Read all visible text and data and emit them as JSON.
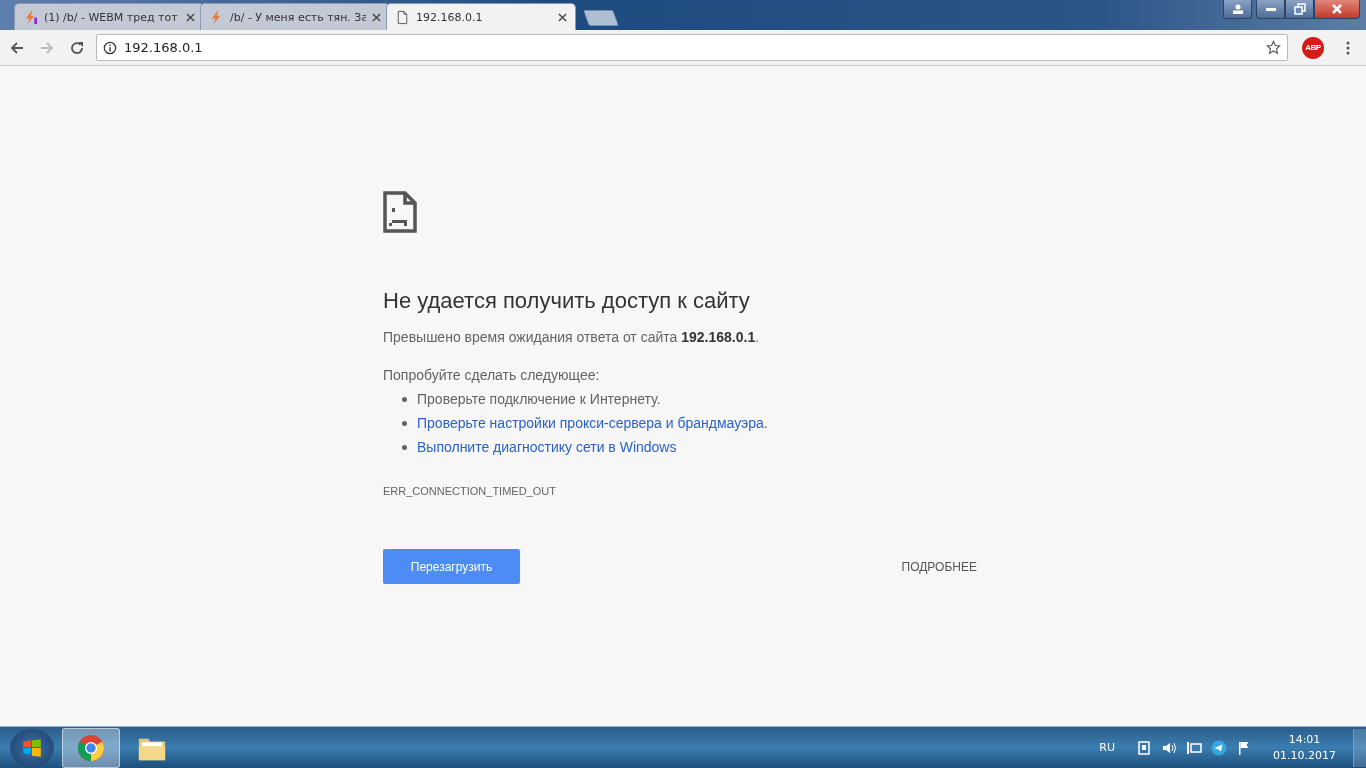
{
  "tabs": [
    {
      "title": "(1) /b/ - WEBM тред тот",
      "selected": false,
      "kind": "alert"
    },
    {
      "title": "/b/ - У меня есть тян. За",
      "selected": false,
      "kind": "normal"
    },
    {
      "title": "192.168.0.1",
      "selected": true,
      "kind": "error"
    }
  ],
  "address_bar": {
    "value": "192.168.0.1"
  },
  "extension": {
    "label": "ABP"
  },
  "error": {
    "title": "Не удается получить доступ к сайту",
    "message": "Превышено время ожидания ответа от сайта **192.168.0.1**.",
    "suggestions_heading": "Попробуйте сделать следующее:",
    "suggestions": [
      {
        "text": "Проверьте подключение к Интернету.",
        "kind": "text"
      },
      {
        "text": "Проверьте настройки прокси-сервера и брандмауэра.",
        "kind": "link"
      },
      {
        "text": "Выполните диагностику сети в Windows",
        "kind": "link"
      }
    ],
    "code": "ERR_CONNECTION_TIMED_OUT",
    "reload_button": "Перезагрузить",
    "details_button": "ПОДРОБНЕЕ"
  },
  "taskbar": {
    "items": [
      {
        "kind": "browser",
        "selected": true
      },
      {
        "kind": "explorer",
        "selected": false
      }
    ],
    "language": "RU",
    "time": "14:01",
    "date": "01.10.2017"
  }
}
